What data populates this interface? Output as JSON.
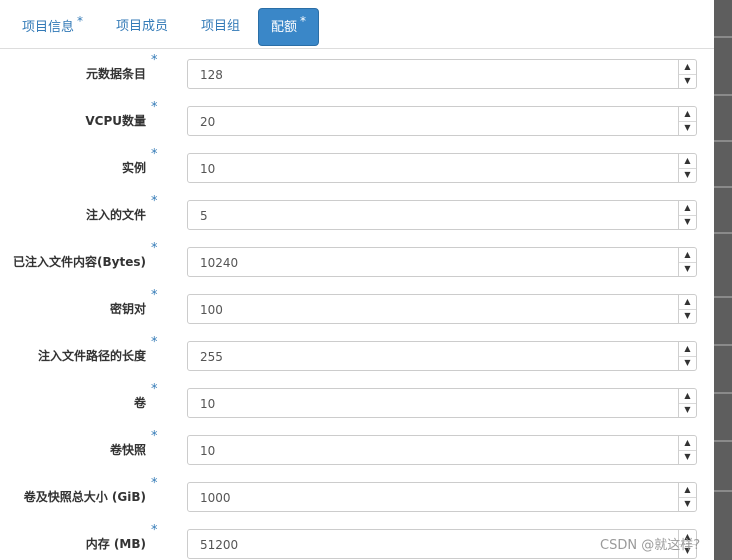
{
  "tabs": [
    {
      "label": "项目信息",
      "required": "*"
    },
    {
      "label": "项目成员"
    },
    {
      "label": "项目组"
    },
    {
      "label": "配额",
      "required": "*"
    }
  ],
  "form": {
    "required_mark": "*",
    "fields": [
      {
        "label": "元数据条目",
        "value": "128"
      },
      {
        "label": "VCPU数量",
        "value": "20"
      },
      {
        "label": "实例",
        "value": "10"
      },
      {
        "label": "注入的文件",
        "value": "5"
      },
      {
        "label": "已注入文件内容(Bytes)",
        "value": "10240"
      },
      {
        "label": "密钥对",
        "value": "100"
      },
      {
        "label": "注入文件路径的长度",
        "value": "255"
      },
      {
        "label": "卷",
        "value": "10"
      },
      {
        "label": "卷快照",
        "value": "10"
      },
      {
        "label": "卷及快照总大小 (GiB)",
        "value": "1000"
      },
      {
        "label": "内存 (MB)",
        "value": "51200"
      }
    ]
  },
  "spinner": {
    "up_icon": "▲",
    "down_icon": "▼"
  },
  "watermark": "CSDN @就这样?",
  "colors": {
    "accent": "#3a87c8",
    "link": "#337ab7",
    "label": "#333333",
    "backdrop": "#5e5e5e"
  }
}
